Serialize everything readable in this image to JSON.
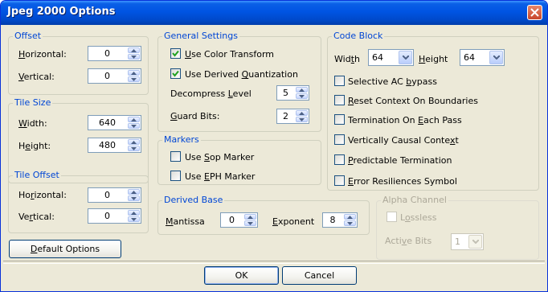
{
  "window": {
    "title": "Jpeg 2000 Options"
  },
  "offset": {
    "title": "Offset",
    "horizontal": {
      "pre": "",
      "key": "H",
      "post": "orizontal:",
      "value": "0"
    },
    "vertical": {
      "pre": "",
      "key": "V",
      "post": "ertical:",
      "value": "0"
    }
  },
  "tile_size": {
    "title": "Tile Size",
    "width": {
      "pre": "",
      "key": "W",
      "post": "idth:",
      "value": "640"
    },
    "height": {
      "pre": "H",
      "key": "e",
      "post": "ight:",
      "value": "480"
    }
  },
  "tile_offset": {
    "title": "Tile Offset",
    "horizontal": {
      "pre": "Ho",
      "key": "r",
      "post": "izontal:",
      "value": "0"
    },
    "vertical": {
      "pre": "Ve",
      "key": "r",
      "post": "tical:",
      "value": "0"
    }
  },
  "default_options": {
    "pre": "",
    "key": "D",
    "post": "efault Options"
  },
  "general": {
    "title": "General Settings",
    "color_transform": {
      "pre": "",
      "key": "U",
      "post": "se Color Transform",
      "checked": true
    },
    "derived_quant": {
      "pre": "Use Derived ",
      "key": "Q",
      "post": "uantization",
      "checked": true
    },
    "decompress": {
      "pre": "Decompress ",
      "key": "L",
      "post": "evel",
      "value": "5"
    },
    "guard": {
      "pre": "",
      "key": "G",
      "post": "uard Bits:",
      "value": "2"
    }
  },
  "markers": {
    "title": "Markers",
    "sop": {
      "pre": "Use ",
      "key": "S",
      "post": "op Marker",
      "checked": false
    },
    "eph": {
      "pre": "Use ",
      "key": "E",
      "post": "PH Marker",
      "checked": false
    }
  },
  "derived_base": {
    "title": "Derived Base",
    "mantissa": {
      "pre": "",
      "key": "M",
      "post": "antissa",
      "value": "0"
    },
    "exponent": {
      "pre": "",
      "key": "E",
      "post": "xponent",
      "value": "8"
    }
  },
  "code_block": {
    "title": "Code Block",
    "width": {
      "pre": "Wid",
      "key": "t",
      "post": "h",
      "value": "64"
    },
    "height": {
      "pre": "",
      "key": "H",
      "post": "eight",
      "value": "64"
    },
    "selective": {
      "pre": "Selective AC ",
      "key": "b",
      "post": "ypass",
      "checked": false
    },
    "reset": {
      "pre": "",
      "key": "R",
      "post": "eset Context On Boundaries",
      "checked": false
    },
    "termination": {
      "pre": "Termination On ",
      "key": "E",
      "post": "ach Pass",
      "checked": false
    },
    "vertical": {
      "pre": "Vertically Causal Conte",
      "key": "x",
      "post": "t",
      "checked": false
    },
    "predictable": {
      "pre": "",
      "key": "P",
      "post": "redictable Termination",
      "checked": false
    },
    "error": {
      "pre": "",
      "key": "E",
      "post": "rror Resiliences Symbol",
      "checked": false
    }
  },
  "alpha": {
    "title": "Alpha Channel",
    "lossless": {
      "pre": "L",
      "key": "o",
      "post": "ssless",
      "checked": false
    },
    "active_bits": {
      "pre": "Acti",
      "key": "v",
      "post": "e Bits",
      "value": "1"
    }
  },
  "footer": {
    "ok": "OK",
    "cancel": "Cancel"
  },
  "colors": {
    "title_bar": "#0054e3",
    "group_label": "#0046d5",
    "face": "#ece9d8",
    "disabled": "#aca899"
  }
}
